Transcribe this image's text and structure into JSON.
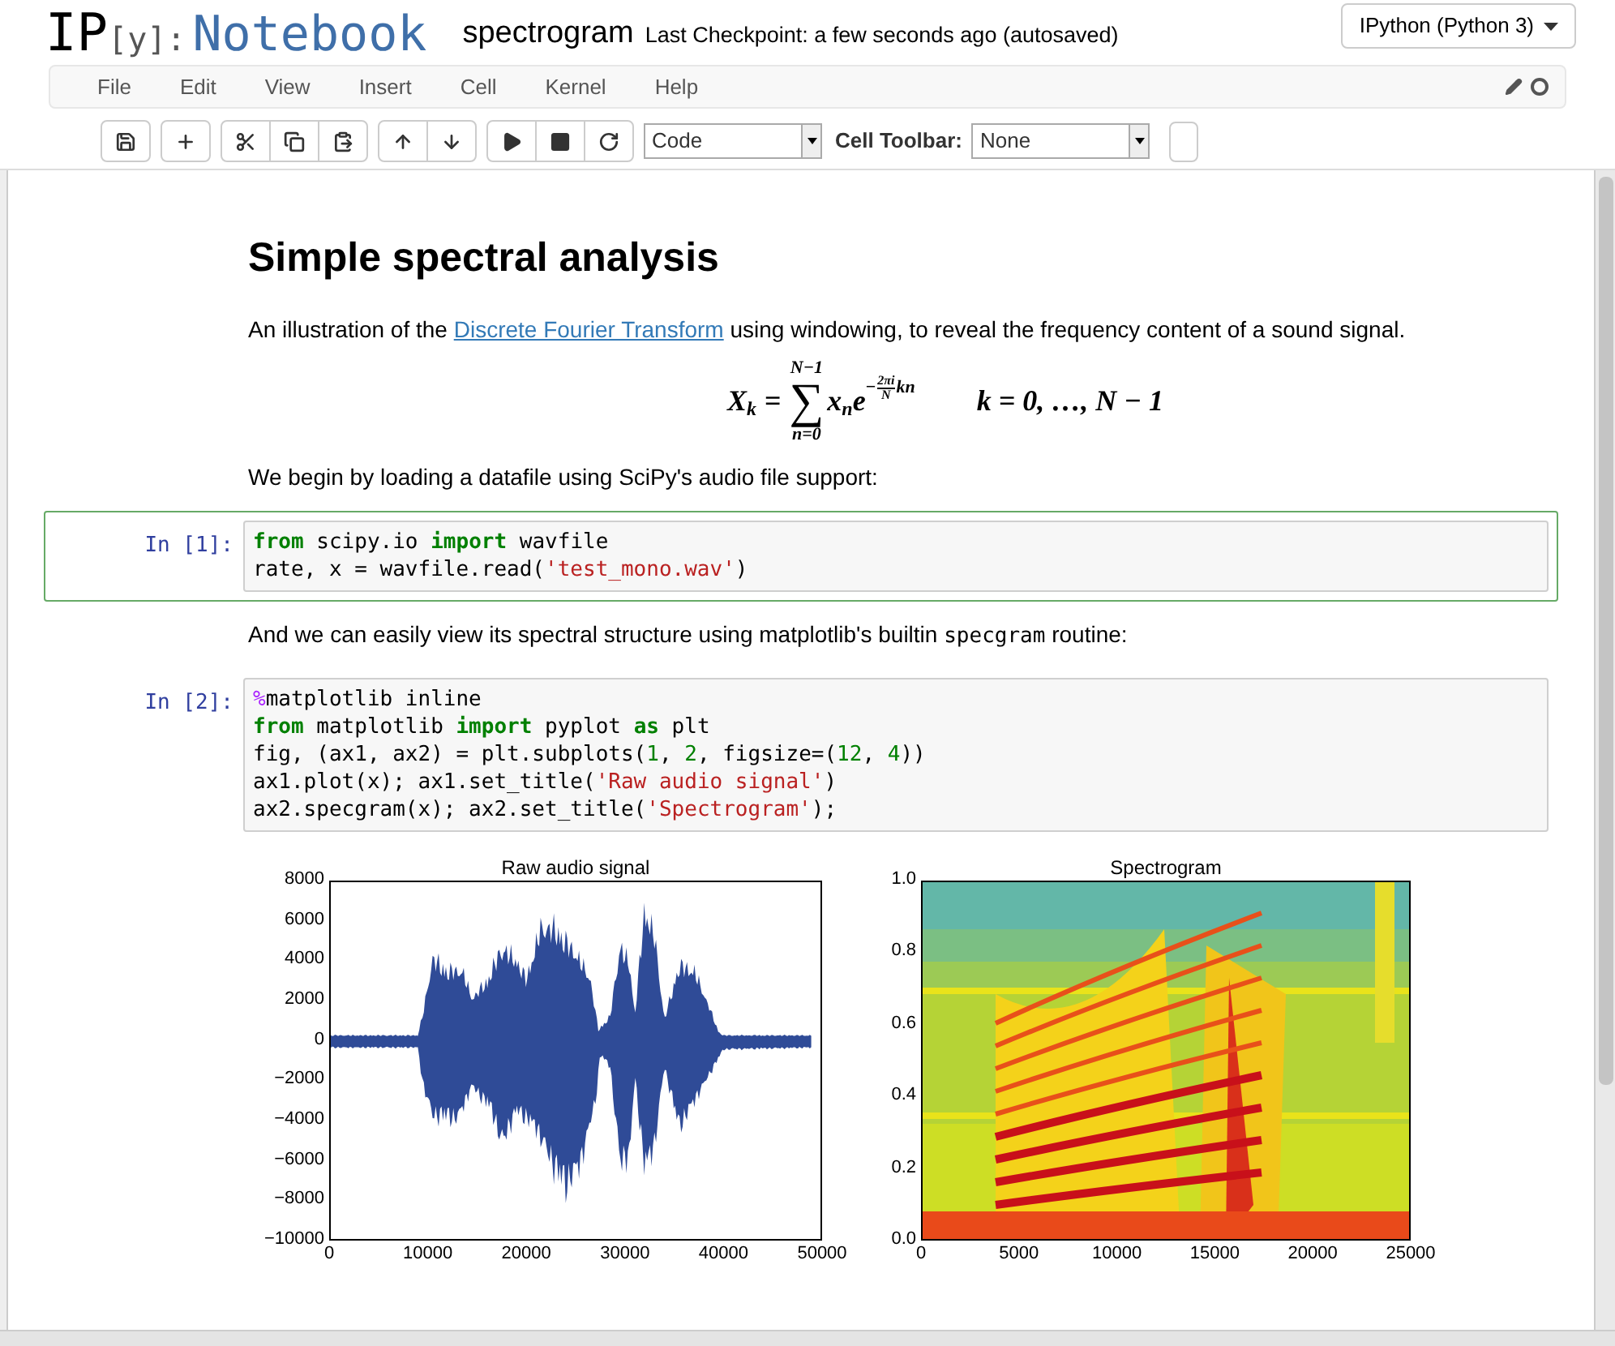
{
  "header": {
    "logo": {
      "mark": "IP",
      "bracket": "[y]:",
      "word": "Notebook"
    },
    "notebook_name": "spectrogram",
    "checkpoint": "Last Checkpoint: a few seconds ago (autosaved)",
    "kernel_button": "IPython (Python 3)"
  },
  "menu": {
    "items": [
      "File",
      "Edit",
      "View",
      "Insert",
      "Cell",
      "Kernel",
      "Help"
    ],
    "kernel_busy": false
  },
  "toolbar": {
    "cell_type": "Code",
    "cell_toolbar_label": "Cell Toolbar:",
    "cell_toolbar_value": "None"
  },
  "cells": [
    {
      "kind": "heading",
      "text": "Simple spectral analysis"
    },
    {
      "kind": "paragraph",
      "parts": [
        {
          "kind": "text",
          "text": "An illustration of the "
        },
        {
          "kind": "link",
          "text": "Discrete Fourier Transform"
        },
        {
          "kind": "text",
          "text": " using windowing, to reveal the frequency content of a sound signal."
        }
      ]
    },
    {
      "kind": "formula",
      "lhs": "X",
      "lhs_sub": "k",
      "equals": "=",
      "sum_upper": "N−1",
      "sum_symbol": "∑",
      "sum_lower": "n=0",
      "term": "x",
      "term_sub": "n",
      "base": "e",
      "exp_sign": "−",
      "frac_num": "2πi",
      "frac_den": "N",
      "exp_tail": "kn",
      "condition": "k = 0, …, N − 1"
    },
    {
      "kind": "paragraph",
      "parts": [
        {
          "kind": "text",
          "text": "We begin by loading a datafile using SciPy's audio file support:"
        }
      ]
    },
    {
      "kind": "code",
      "prompt": "In [1]:",
      "selected": true,
      "lines": [
        [
          {
            "kind": "keyword",
            "text": "from"
          },
          {
            "kind": "plain",
            "text": " scipy.io "
          },
          {
            "kind": "keyword",
            "text": "import"
          },
          {
            "kind": "plain",
            "text": " wavfile"
          }
        ],
        [
          {
            "kind": "plain",
            "text": "rate, x = wavfile.read("
          },
          {
            "kind": "string",
            "text": "'test_mono.wav'"
          },
          {
            "kind": "plain",
            "text": ")"
          }
        ]
      ]
    },
    {
      "kind": "paragraph",
      "parts": [
        {
          "kind": "text",
          "text": "And we can easily view its spectral structure using matplotlib's builtin "
        },
        {
          "kind": "code",
          "text": "specgram"
        },
        {
          "kind": "text",
          "text": " routine:"
        }
      ]
    },
    {
      "kind": "code",
      "prompt": "In [2]:",
      "selected": false,
      "lines": [
        [
          {
            "kind": "magic",
            "text": "%"
          },
          {
            "kind": "plain",
            "text": "matplotlib inline"
          }
        ],
        [
          {
            "kind": "keyword",
            "text": "from"
          },
          {
            "kind": "plain",
            "text": " matplotlib "
          },
          {
            "kind": "keyword",
            "text": "import"
          },
          {
            "kind": "plain",
            "text": " pyplot "
          },
          {
            "kind": "keyword",
            "text": "as"
          },
          {
            "kind": "plain",
            "text": " plt"
          }
        ],
        [
          {
            "kind": "plain",
            "text": "fig, (ax1, ax2) = plt.subplots("
          },
          {
            "kind": "number",
            "text": "1"
          },
          {
            "kind": "plain",
            "text": ", "
          },
          {
            "kind": "number",
            "text": "2"
          },
          {
            "kind": "plain",
            "text": ", figsize=("
          },
          {
            "kind": "number",
            "text": "12"
          },
          {
            "kind": "plain",
            "text": ", "
          },
          {
            "kind": "number",
            "text": "4"
          },
          {
            "kind": "plain",
            "text": "))"
          }
        ],
        [
          {
            "kind": "plain",
            "text": "ax1.plot(x); ax1.set_title("
          },
          {
            "kind": "string",
            "text": "'Raw audio signal'"
          },
          {
            "kind": "plain",
            "text": ")"
          }
        ],
        [
          {
            "kind": "plain",
            "text": "ax2.specgram(x); ax2.set_title("
          },
          {
            "kind": "string",
            "text": "'Spectrogram'"
          },
          {
            "kind": "plain",
            "text": ");"
          }
        ]
      ]
    },
    {
      "kind": "output",
      "plots": [
        {
          "kind": "waveform",
          "title": "Raw audio signal",
          "yticks": [
            "8000",
            "6000",
            "4000",
            "2000",
            "0",
            "−2000",
            "−4000",
            "−6000",
            "−8000",
            "−10000"
          ],
          "xticks": [
            "0",
            "10000",
            "20000",
            "30000",
            "40000",
            "50000"
          ]
        },
        {
          "kind": "spectrogram",
          "title": "Spectrogram",
          "yticks": [
            "1.0",
            "0.8",
            "0.6",
            "0.4",
            "0.2",
            "0.0"
          ],
          "xticks": [
            "0",
            "5000",
            "10000",
            "15000",
            "20000",
            "25000"
          ]
        }
      ]
    }
  ]
}
